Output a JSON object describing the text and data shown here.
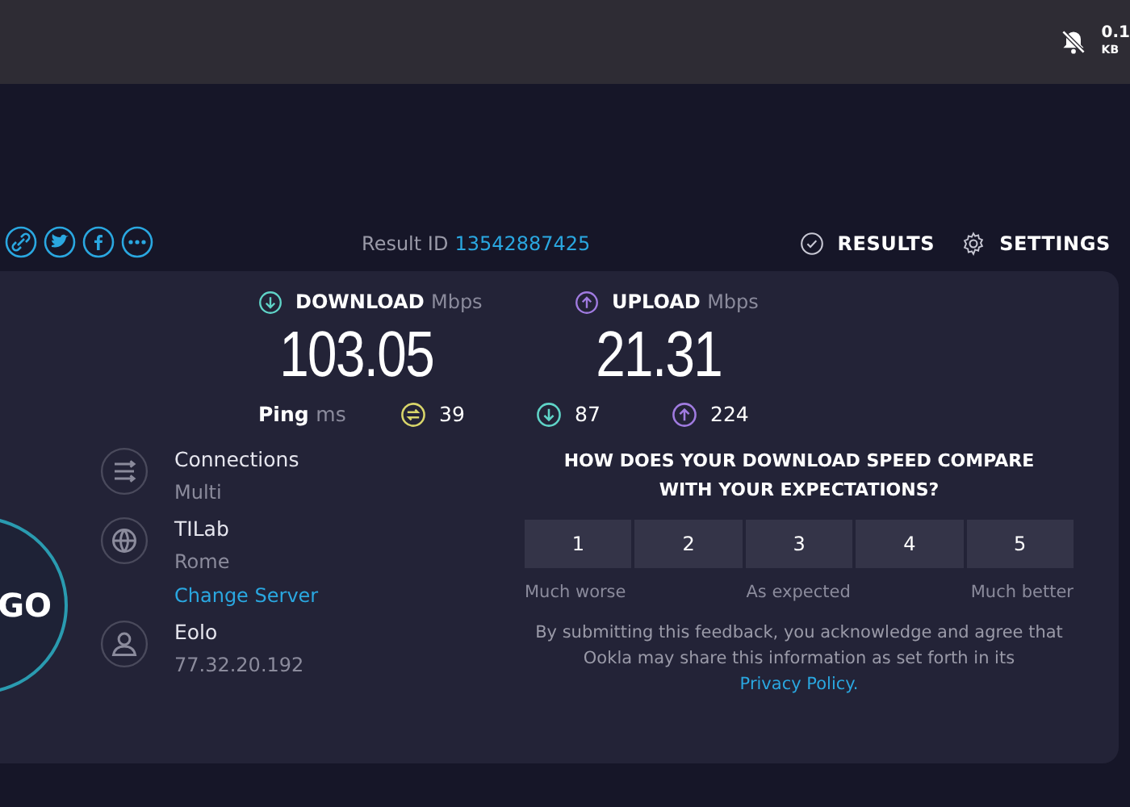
{
  "status_bar": {
    "speed": "0.1",
    "unit": "KB"
  },
  "result": {
    "label": "Result ID",
    "id": "13542887425"
  },
  "nav": [
    {
      "kind": "results",
      "label": "RESULTS"
    },
    {
      "kind": "settings",
      "label": "SETTINGS"
    }
  ],
  "speeds": [
    {
      "kind": "download",
      "label": "DOWNLOAD",
      "unit": "Mbps",
      "value": "103.05",
      "color": "#5fd3c7"
    },
    {
      "kind": "upload",
      "label": "UPLOAD",
      "unit": "Mbps",
      "value": "21.31",
      "color": "#a07be0"
    }
  ],
  "ping": {
    "label": "Ping",
    "unit": "ms",
    "readings": [
      {
        "kind": "idle",
        "value": "39",
        "color": "#d8d56a"
      },
      {
        "kind": "download",
        "value": "87",
        "color": "#5fd3c7"
      },
      {
        "kind": "upload",
        "value": "224",
        "color": "#a07be0"
      }
    ]
  },
  "go_button": {
    "label": "GO"
  },
  "info": [
    {
      "kind": "connections",
      "title": "Connections",
      "detail": "Multi"
    },
    {
      "kind": "server",
      "title": "TILab",
      "detail": "Rome",
      "link": "Change Server"
    },
    {
      "kind": "provider",
      "title": "Eolo",
      "detail": "77.32.20.192"
    }
  ],
  "feedback": {
    "question": "HOW DOES YOUR DOWNLOAD SPEED COMPARE WITH YOUR EXPECTATIONS?",
    "ratings": [
      {
        "label": "1",
        "selected": false
      },
      {
        "label": "2",
        "selected": false
      },
      {
        "label": "3",
        "selected": false
      },
      {
        "label": "4",
        "selected": false
      },
      {
        "label": "5",
        "selected": false
      }
    ],
    "scale_labels": [
      "Much worse",
      "As expected",
      "Much better"
    ],
    "notice": "By submitting this feedback, you acknowledge and agree that Ookla may share this information as set forth in its",
    "link": "Privacy Policy."
  }
}
